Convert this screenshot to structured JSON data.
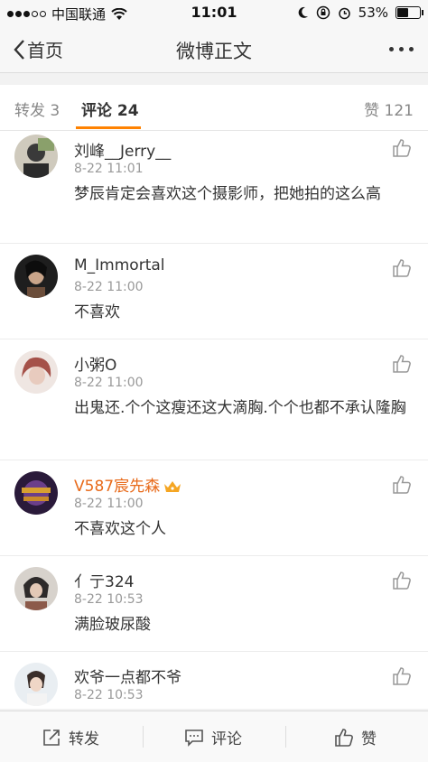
{
  "status_bar": {
    "carrier": "中国联通",
    "time": "11:01",
    "battery": "53%",
    "battery_level": 0.53
  },
  "navbar": {
    "back_label": "首页",
    "title": "微博正文"
  },
  "tabs": {
    "repost": "转发 3",
    "comments": "评论 24",
    "likes": "赞 121"
  },
  "comments": [
    {
      "user": "刘峰__Jerry__",
      "time": "8-22 11:01",
      "text": "梦辰肯定会喜欢这个摄影师，把她拍的这么高",
      "vip": false
    },
    {
      "user": "M_Immortal",
      "time": "8-22 11:00",
      "text": "不喜欢",
      "vip": false
    },
    {
      "user": "小粥O",
      "time": "8-22 11:00",
      "text": "出鬼还.个个这瘦还这大滴胸.个个也都不承认隆胸",
      "vip": false
    },
    {
      "user": "V587宸先森",
      "time": "8-22 11:00",
      "text": "不喜欢这个人",
      "vip": true
    },
    {
      "user": "亻亍324",
      "time": "8-22 10:53",
      "text": "满脸玻尿酸",
      "vip": false
    },
    {
      "user": "欢爷一点都不爷",
      "time": "8-22 10:53",
      "text": "",
      "vip": false
    }
  ],
  "bottom_bar": {
    "repost": "转发",
    "comment": "评论",
    "like": "赞"
  }
}
